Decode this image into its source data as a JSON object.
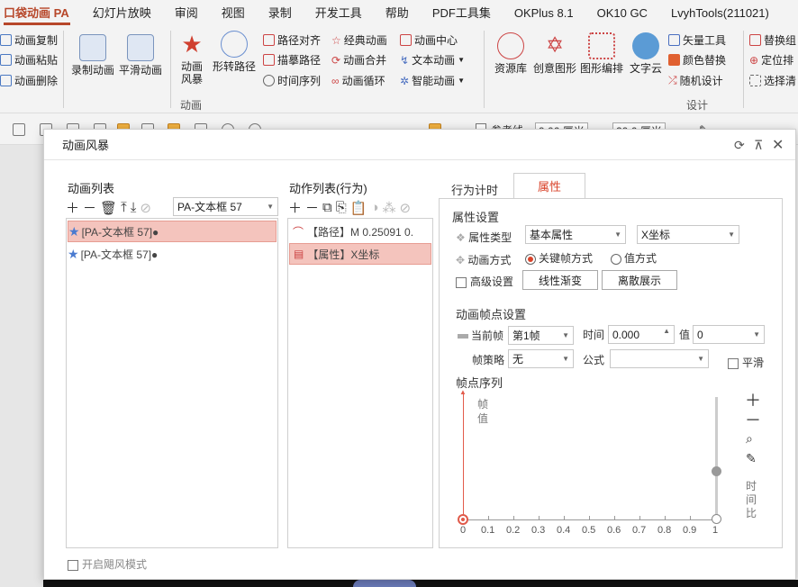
{
  "menu_tabs": [
    "口袋动画 PA",
    "幻灯片放映",
    "审阅",
    "视图",
    "录制",
    "开发工具",
    "帮助",
    "PDF工具集",
    "OKPlus 8.1",
    "OK10 GC",
    "LvyhTools(211021)"
  ],
  "ribbon": {
    "left_items": [
      "动画复制",
      "动画粘贴",
      "动画删除"
    ],
    "record": "录制动画",
    "smooth": "平滑动画",
    "storm": "动画\n风暴",
    "shape_path": "形转路径",
    "col1": [
      "路径对齐",
      "描摹路径",
      "时间序列"
    ],
    "col2": [
      "经典动画",
      "动画合并",
      "动画循环"
    ],
    "col3": [
      "动画中心",
      "文本动画",
      "智能动画"
    ],
    "group_anim": "动画",
    "resource": "资源库",
    "creative": "创意图形",
    "shape_arrange": "图形编排",
    "text_cloud": "文字云",
    "col4": [
      "矢量工具",
      "颜色替换",
      "随机设计"
    ],
    "col5": [
      "替换组",
      "定位排",
      "选择清"
    ],
    "group_design": "设计"
  },
  "toolbar2": {
    "ref_line": "参考线",
    "width_val": "9.06 厘米",
    "height_val": "20.6 厘米"
  },
  "dialog": {
    "title": "动画风暴",
    "anim_list": {
      "title": "动画列表",
      "target": "PA-文本框 57",
      "rows": [
        "[PA-文本框 57]●",
        "[PA-文本框 57]●"
      ]
    },
    "action_list": {
      "title": "动作列表(行为)",
      "rows": [
        "【路径】M 0.25091 0.",
        "【属性】X坐标"
      ]
    },
    "tabs": [
      "行为计时",
      "属性"
    ],
    "prop": {
      "section": "属性设置",
      "type_label": "属性类型",
      "type_value": "基本属性",
      "attr_value": "X坐标",
      "mode_label": "动画方式",
      "mode_opt1": "关键帧方式",
      "mode_opt2": "值方式",
      "adv_label": "高级设置",
      "btn_linear": "线性渐变",
      "btn_discrete": "离散展示",
      "frame_section": "动画帧点设置",
      "cur_frame_label": "当前帧",
      "cur_frame_value": "第1帧",
      "time_label": "时间",
      "time_value": "0.000",
      "value_label": "值",
      "value_value": "0",
      "strategy_label": "帧策略",
      "strategy_value": "无",
      "formula_label": "公式",
      "formula_value": "",
      "smooth_label": "平滑",
      "seq_title": "帧点序列",
      "y_axis": "帧\n值",
      "x_ticks": [
        "0",
        "0.1",
        "0.2",
        "0.3",
        "0.4",
        "0.5",
        "0.6",
        "0.7",
        "0.8",
        "0.9",
        "1"
      ],
      "right_axis": "时\n间\n比",
      "first_frame": {
        "time": 0,
        "value": 0
      },
      "time_ratio_slider": 0.4
    },
    "storm_mode": "开启飓风模式"
  },
  "colors": {
    "accent": "#b7472a",
    "selection": "#f4c4bd",
    "keyframe": "#e05a4a"
  }
}
